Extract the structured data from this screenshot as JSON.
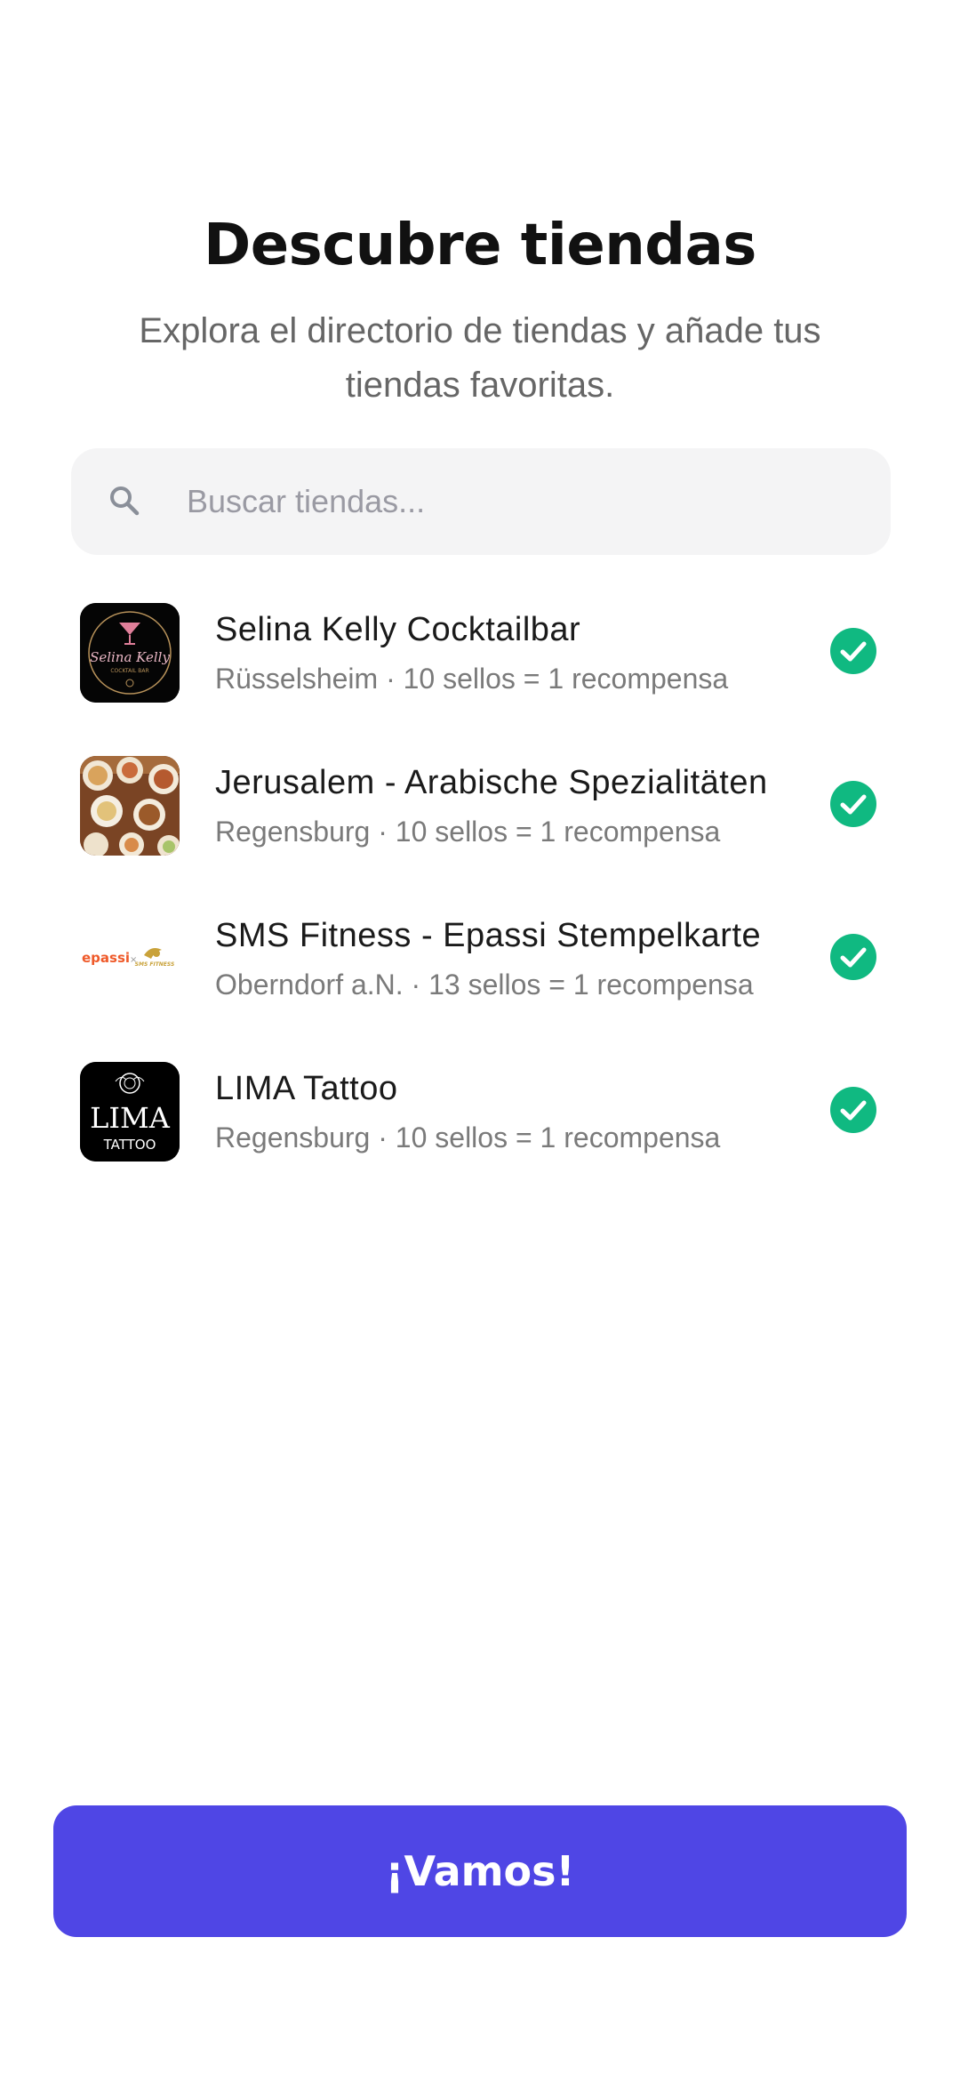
{
  "header": {
    "title": "Descubre tiendas",
    "subtitle": "Explora el directorio de tiendas y añade tus tiendas favoritas."
  },
  "search": {
    "placeholder": "Buscar tiendas...",
    "value": "",
    "icon": "search-icon"
  },
  "stores": [
    {
      "name": "Selina Kelly Cocktailbar",
      "subtitle": "Rüsselsheim · 10 sellos = 1 recompensa",
      "logo_icon": "cocktail-logo",
      "logo_text": "Selina Kelly",
      "logo_subtext": "COCKTAIL BAR",
      "selected": true
    },
    {
      "name": "Jerusalem - Arabische Spezialitäten",
      "subtitle": "Regensburg · 10 sellos = 1 recompensa",
      "logo_icon": "food-platter-logo",
      "selected": true
    },
    {
      "name": "SMS Fitness - Epassi Stempelkarte",
      "subtitle": "Oberndorf a.N. · 13 sellos = 1 recompensa",
      "logo_icon": "epassi-logo",
      "logo_text": "epassi",
      "logo_subtext": "SMS FITNESS",
      "selected": true
    },
    {
      "name": "LIMA Tattoo",
      "subtitle": "Regensburg · 10 sellos = 1 recompensa",
      "logo_icon": "lima-tattoo-logo",
      "logo_text": "LIMA",
      "logo_subtext": "TATTOO",
      "selected": true
    }
  ],
  "cta": {
    "label": "¡Vamos!"
  },
  "colors": {
    "accent": "#4f46e5",
    "check": "#10b981",
    "title": "#111111",
    "muted": "#7a7a7a",
    "search_bg": "#f4f4f5"
  }
}
